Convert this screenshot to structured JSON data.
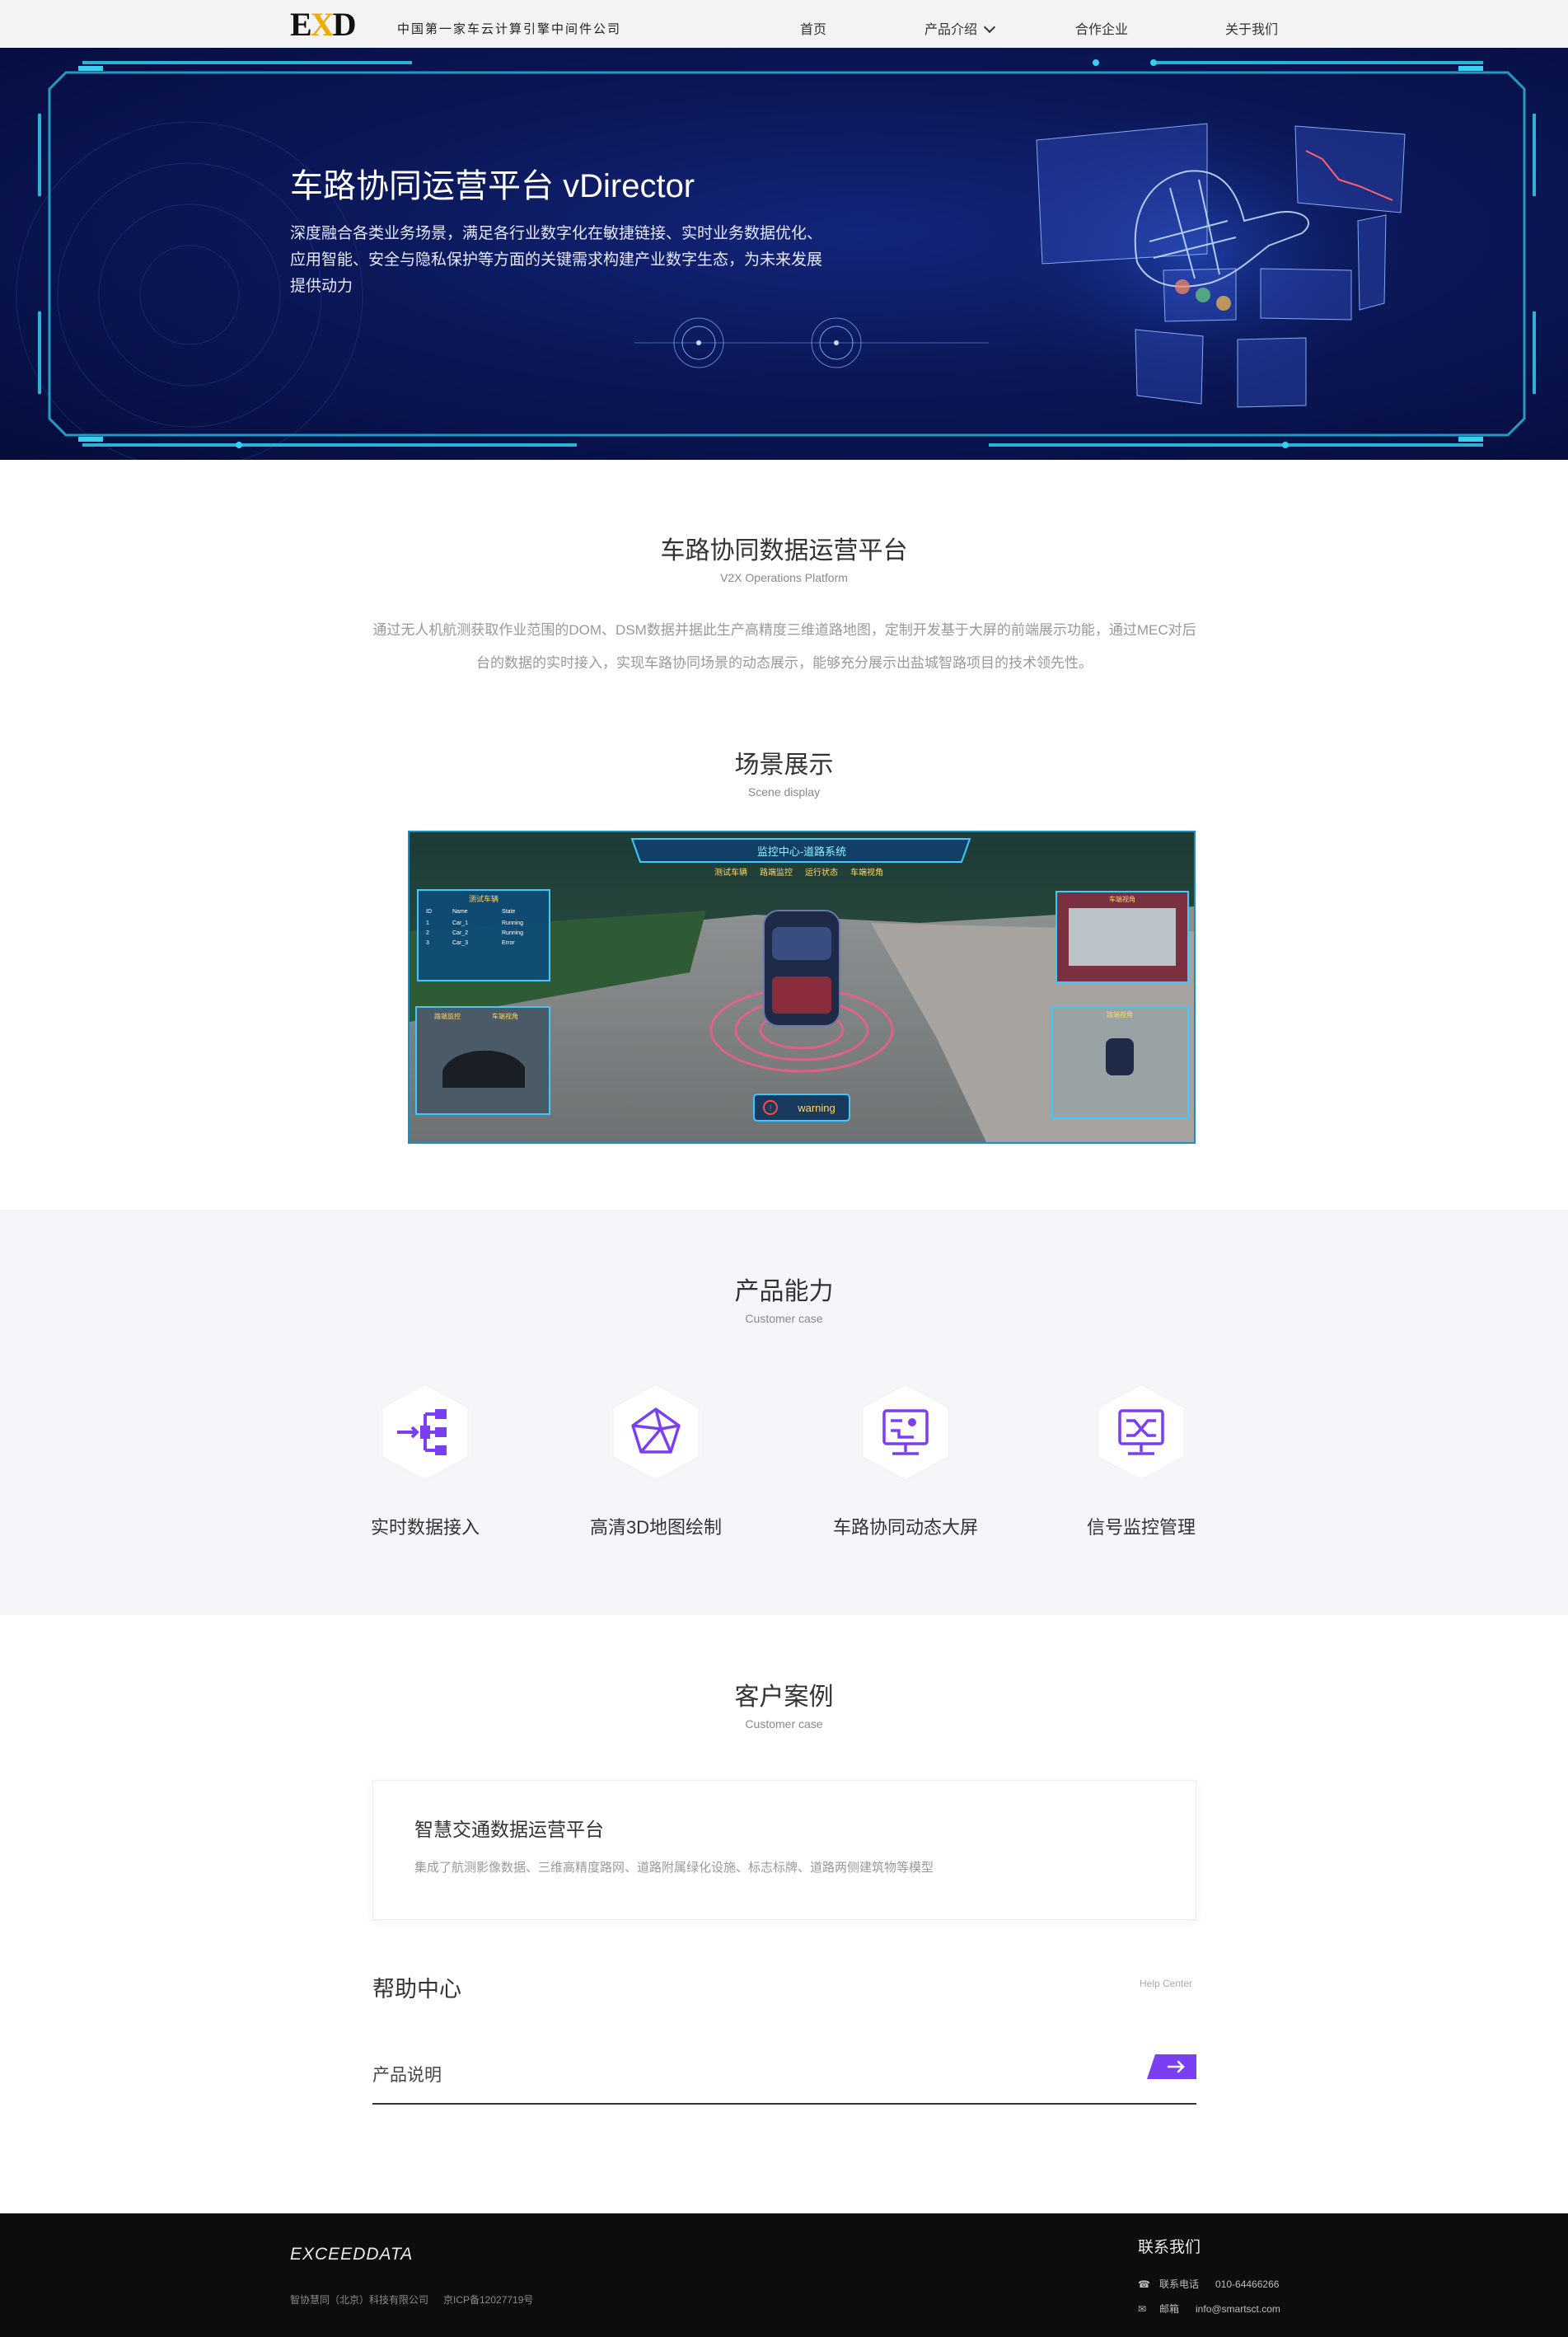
{
  "header": {
    "logo": "EXD",
    "tagline": "中国第一家车云计算引擎中间件公司",
    "nav": [
      {
        "label": "首页"
      },
      {
        "label": "产品介绍"
      },
      {
        "label": "合作企业"
      },
      {
        "label": "关于我们"
      }
    ]
  },
  "hero": {
    "title": "车路协同运营平台 vDirector",
    "description": "深度融合各类业务场景，满足各行业数字化在敏捷链接、实时业务数据优化、应用智能、安全与隐私保护等方面的关键需求构建产业数字生态，为未来发展提供动力"
  },
  "intro": {
    "title": "车路协同数据运营平台",
    "subtitle": "V2X Operations Platform",
    "text": "通过无人机航测获取作业范围的DOM、DSM数据并据此生产高精度三维道路地图，定制开发基于大屏的前端展示功能，通过MEC对后台的数据的实时接入，实现车路协同场景的动态展示，能够充分展示出盐城智路项目的技术领先性。"
  },
  "scene": {
    "title": "场景展示",
    "subtitle": "Scene display",
    "screen": {
      "header": "监控中心-道路系统",
      "tabs": [
        "测试车辆",
        "路端监控",
        "运行状态",
        "车端视角"
      ],
      "table_title": "测试车辆",
      "table_cols": [
        "ID",
        "Name",
        "State"
      ],
      "table_rows": [
        [
          "1",
          "Car_1",
          "Running"
        ],
        [
          "2",
          "Car_2",
          "Running"
        ],
        [
          "3",
          "Car_3",
          "Error"
        ]
      ],
      "left_bottom_tags": [
        "路端监控",
        "车端视角"
      ],
      "right_top_title": "车端视角",
      "right_bottom_title": "路端视角",
      "warning": "warning"
    }
  },
  "abilities": {
    "title": "产品能力",
    "subtitle": "Customer case",
    "items": [
      {
        "label": "实时数据接入",
        "icon": "data-flow-icon"
      },
      {
        "label": "高清3D地图绘制",
        "icon": "polygon-map-icon"
      },
      {
        "label": "车路协同动态大屏",
        "icon": "dashboard-screen-icon"
      },
      {
        "label": "信号监控管理",
        "icon": "signal-monitor-icon"
      }
    ],
    "icon_color": "#7b3ff2"
  },
  "cases": {
    "title": "客户案例",
    "subtitle": "Customer case",
    "card_title": "智慧交通数据运营平台",
    "card_desc": "集成了航测影像数据、三维高精度路网、道路附属绿化设施、标志标牌、道路两侧建筑物等模型"
  },
  "help": {
    "title": "帮助中心",
    "subtitle": "Help Center",
    "row_label": "产品说明",
    "accent": "#7b3ff2"
  },
  "footer": {
    "logo": "EXCEEDDATA",
    "company": "智协慧同（北京）科技有限公司",
    "icp": "京ICP备12027719号",
    "contact_title": "联系我们",
    "phone_label": "联系电话",
    "phone": "010-64466266",
    "email_label": "邮箱",
    "email": "info@smartsct.com"
  }
}
